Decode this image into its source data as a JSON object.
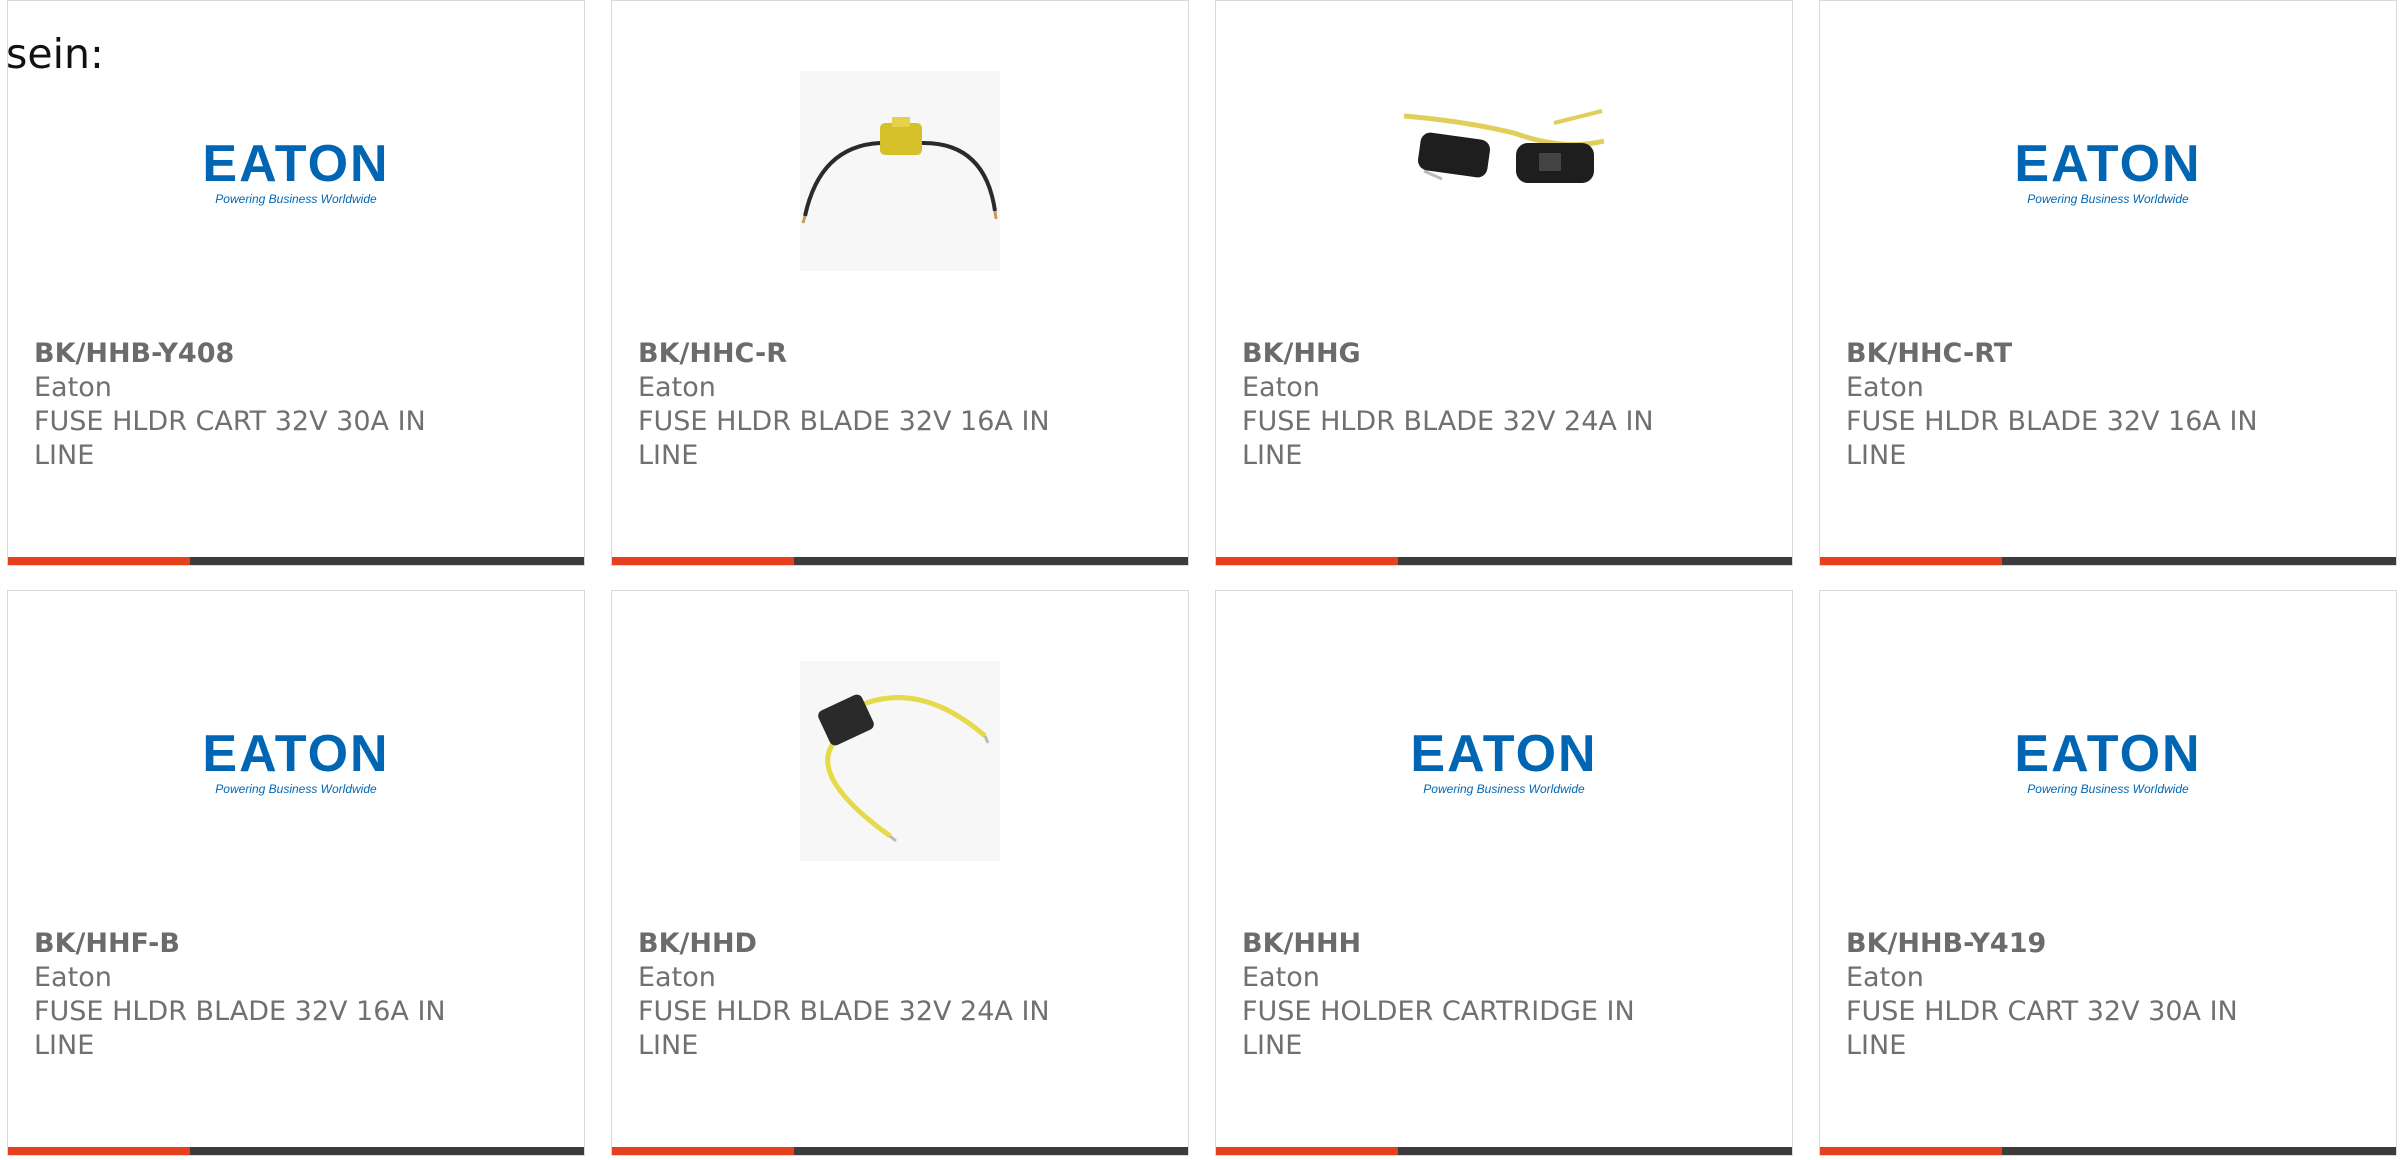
{
  "intro_text": "sein:",
  "brand": {
    "logo_word": "EATON",
    "logo_tagline": "Powering Business Worldwide",
    "logo_color": "#0066b3"
  },
  "accent_color": "#e8401c",
  "bar_color": "#3b3b3b",
  "products": [
    {
      "part": "BK/HHB-Y408",
      "maker": "Eaton",
      "desc1": "FUSE HLDR CART 32V 30A IN",
      "desc2": "LINE",
      "image": "eaton-logo"
    },
    {
      "part": "BK/HHC-R",
      "maker": "Eaton",
      "desc1": "FUSE HLDR BLADE 32V 16A IN",
      "desc2": "LINE",
      "image": "yellow-fuse-holder-photo"
    },
    {
      "part": "BK/HHG",
      "maker": "Eaton",
      "desc1": "FUSE HLDR BLADE 32V 24A IN",
      "desc2": "LINE",
      "image": "black-fuse-holder-photo"
    },
    {
      "part": "BK/HHC-RT",
      "maker": "Eaton",
      "desc1": "FUSE HLDR BLADE 32V 16A IN",
      "desc2": "LINE",
      "image": "eaton-logo"
    },
    {
      "part": "BK/HHF-B",
      "maker": "Eaton",
      "desc1": "FUSE HLDR BLADE 32V 16A IN",
      "desc2": "LINE",
      "image": "eaton-logo"
    },
    {
      "part": "BK/HHD",
      "maker": "Eaton",
      "desc1": "FUSE HLDR BLADE 32V 24A IN",
      "desc2": "LINE",
      "image": "black-fuse-holder-yellow-wire-photo"
    },
    {
      "part": "BK/HHH",
      "maker": "Eaton",
      "desc1": "FUSE HOLDER CARTRIDGE IN",
      "desc2": "LINE",
      "image": "eaton-logo"
    },
    {
      "part": "BK/HHB-Y419",
      "maker": "Eaton",
      "desc1": "FUSE HLDR CART 32V 30A IN",
      "desc2": "LINE",
      "image": "eaton-logo"
    }
  ]
}
